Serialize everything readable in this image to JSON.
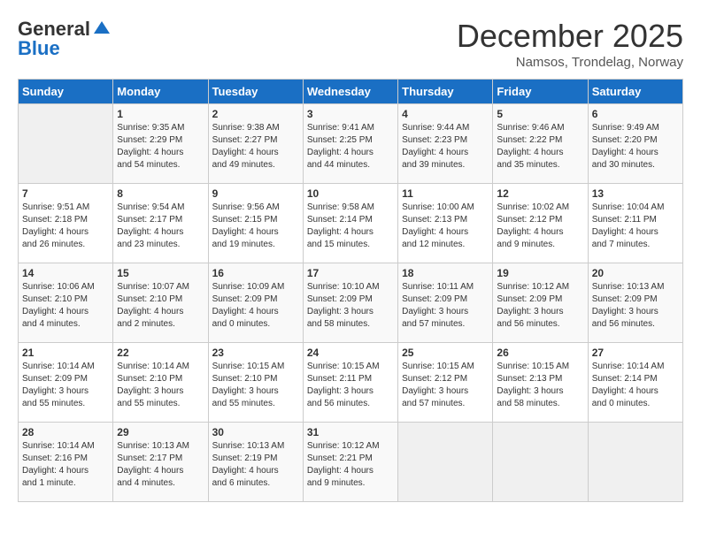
{
  "header": {
    "logo_general": "General",
    "logo_blue": "Blue",
    "month_title": "December 2025",
    "location": "Namsos, Trondelag, Norway"
  },
  "days_of_week": [
    "Sunday",
    "Monday",
    "Tuesday",
    "Wednesday",
    "Thursday",
    "Friday",
    "Saturday"
  ],
  "weeks": [
    [
      {
        "num": "",
        "info": ""
      },
      {
        "num": "1",
        "info": "Sunrise: 9:35 AM\nSunset: 2:29 PM\nDaylight: 4 hours\nand 54 minutes."
      },
      {
        "num": "2",
        "info": "Sunrise: 9:38 AM\nSunset: 2:27 PM\nDaylight: 4 hours\nand 49 minutes."
      },
      {
        "num": "3",
        "info": "Sunrise: 9:41 AM\nSunset: 2:25 PM\nDaylight: 4 hours\nand 44 minutes."
      },
      {
        "num": "4",
        "info": "Sunrise: 9:44 AM\nSunset: 2:23 PM\nDaylight: 4 hours\nand 39 minutes."
      },
      {
        "num": "5",
        "info": "Sunrise: 9:46 AM\nSunset: 2:22 PM\nDaylight: 4 hours\nand 35 minutes."
      },
      {
        "num": "6",
        "info": "Sunrise: 9:49 AM\nSunset: 2:20 PM\nDaylight: 4 hours\nand 30 minutes."
      }
    ],
    [
      {
        "num": "7",
        "info": "Sunrise: 9:51 AM\nSunset: 2:18 PM\nDaylight: 4 hours\nand 26 minutes."
      },
      {
        "num": "8",
        "info": "Sunrise: 9:54 AM\nSunset: 2:17 PM\nDaylight: 4 hours\nand 23 minutes."
      },
      {
        "num": "9",
        "info": "Sunrise: 9:56 AM\nSunset: 2:15 PM\nDaylight: 4 hours\nand 19 minutes."
      },
      {
        "num": "10",
        "info": "Sunrise: 9:58 AM\nSunset: 2:14 PM\nDaylight: 4 hours\nand 15 minutes."
      },
      {
        "num": "11",
        "info": "Sunrise: 10:00 AM\nSunset: 2:13 PM\nDaylight: 4 hours\nand 12 minutes."
      },
      {
        "num": "12",
        "info": "Sunrise: 10:02 AM\nSunset: 2:12 PM\nDaylight: 4 hours\nand 9 minutes."
      },
      {
        "num": "13",
        "info": "Sunrise: 10:04 AM\nSunset: 2:11 PM\nDaylight: 4 hours\nand 7 minutes."
      }
    ],
    [
      {
        "num": "14",
        "info": "Sunrise: 10:06 AM\nSunset: 2:10 PM\nDaylight: 4 hours\nand 4 minutes."
      },
      {
        "num": "15",
        "info": "Sunrise: 10:07 AM\nSunset: 2:10 PM\nDaylight: 4 hours\nand 2 minutes."
      },
      {
        "num": "16",
        "info": "Sunrise: 10:09 AM\nSunset: 2:09 PM\nDaylight: 4 hours\nand 0 minutes."
      },
      {
        "num": "17",
        "info": "Sunrise: 10:10 AM\nSunset: 2:09 PM\nDaylight: 3 hours\nand 58 minutes."
      },
      {
        "num": "18",
        "info": "Sunrise: 10:11 AM\nSunset: 2:09 PM\nDaylight: 3 hours\nand 57 minutes."
      },
      {
        "num": "19",
        "info": "Sunrise: 10:12 AM\nSunset: 2:09 PM\nDaylight: 3 hours\nand 56 minutes."
      },
      {
        "num": "20",
        "info": "Sunrise: 10:13 AM\nSunset: 2:09 PM\nDaylight: 3 hours\nand 56 minutes."
      }
    ],
    [
      {
        "num": "21",
        "info": "Sunrise: 10:14 AM\nSunset: 2:09 PM\nDaylight: 3 hours\nand 55 minutes."
      },
      {
        "num": "22",
        "info": "Sunrise: 10:14 AM\nSunset: 2:10 PM\nDaylight: 3 hours\nand 55 minutes."
      },
      {
        "num": "23",
        "info": "Sunrise: 10:15 AM\nSunset: 2:10 PM\nDaylight: 3 hours\nand 55 minutes."
      },
      {
        "num": "24",
        "info": "Sunrise: 10:15 AM\nSunset: 2:11 PM\nDaylight: 3 hours\nand 56 minutes."
      },
      {
        "num": "25",
        "info": "Sunrise: 10:15 AM\nSunset: 2:12 PM\nDaylight: 3 hours\nand 57 minutes."
      },
      {
        "num": "26",
        "info": "Sunrise: 10:15 AM\nSunset: 2:13 PM\nDaylight: 3 hours\nand 58 minutes."
      },
      {
        "num": "27",
        "info": "Sunrise: 10:14 AM\nSunset: 2:14 PM\nDaylight: 4 hours\nand 0 minutes."
      }
    ],
    [
      {
        "num": "28",
        "info": "Sunrise: 10:14 AM\nSunset: 2:16 PM\nDaylight: 4 hours\nand 1 minute."
      },
      {
        "num": "29",
        "info": "Sunrise: 10:13 AM\nSunset: 2:17 PM\nDaylight: 4 hours\nand 4 minutes."
      },
      {
        "num": "30",
        "info": "Sunrise: 10:13 AM\nSunset: 2:19 PM\nDaylight: 4 hours\nand 6 minutes."
      },
      {
        "num": "31",
        "info": "Sunrise: 10:12 AM\nSunset: 2:21 PM\nDaylight: 4 hours\nand 9 minutes."
      },
      {
        "num": "",
        "info": ""
      },
      {
        "num": "",
        "info": ""
      },
      {
        "num": "",
        "info": ""
      }
    ]
  ]
}
